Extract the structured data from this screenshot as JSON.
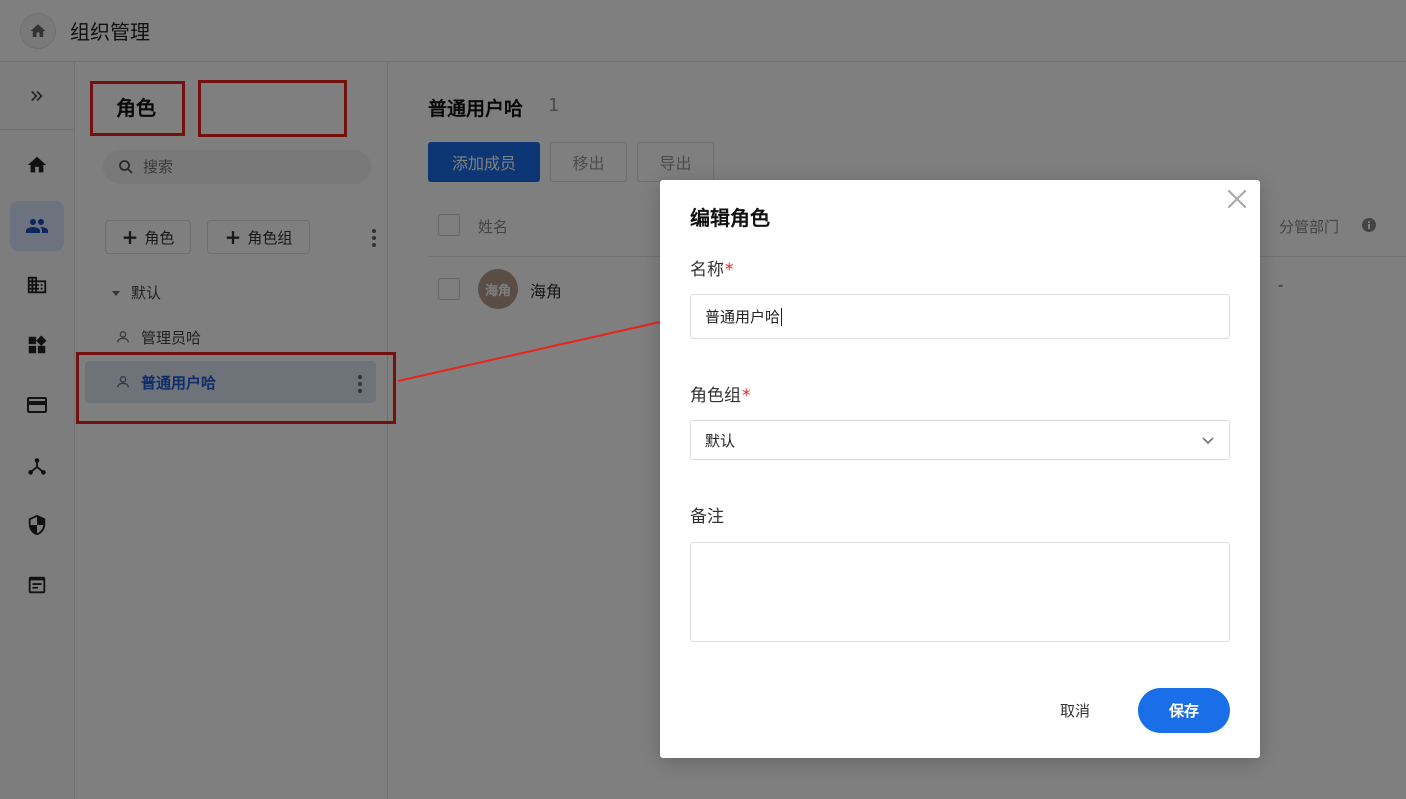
{
  "header": {
    "title": "组织管理"
  },
  "rail": {
    "expand_icon": "double-chevron-right-icon",
    "items": [
      {
        "icon": "home-icon"
      },
      {
        "icon": "people-icon",
        "active": true
      },
      {
        "icon": "building-icon"
      },
      {
        "icon": "apps-icon"
      },
      {
        "icon": "card-icon"
      },
      {
        "icon": "hierarchy-icon"
      },
      {
        "icon": "shield-icon"
      },
      {
        "icon": "document-icon"
      }
    ]
  },
  "role_panel": {
    "title": "角色",
    "search_placeholder": "搜索",
    "add_role_label": "角色",
    "add_group_label": "角色组",
    "group_name": "默认",
    "roles": [
      {
        "label": "管理员哈",
        "selected": false
      },
      {
        "label": "普通用户哈",
        "selected": true
      }
    ]
  },
  "main": {
    "title": "普通用户哈",
    "count": "1",
    "buttons": {
      "add_member": "添加成员",
      "remove": "移出",
      "export": "导出"
    },
    "table": {
      "columns": {
        "name": "姓名",
        "department": "分管部门"
      },
      "rows": [
        {
          "avatar_text": "海角",
          "name": "海角",
          "department": "-"
        }
      ]
    }
  },
  "modal": {
    "title": "编辑角色",
    "name_label": "名称",
    "name_value": "普通用户哈",
    "group_label": "角色组",
    "group_value": "默认",
    "note_label": "备注",
    "note_value": "",
    "required_mark": "*",
    "cancel_label": "取消",
    "save_label": "保存"
  },
  "colors": {
    "primary": "#1a6fe8",
    "annotation_red": "#e8231c",
    "selected_bg": "#dde6f5"
  }
}
